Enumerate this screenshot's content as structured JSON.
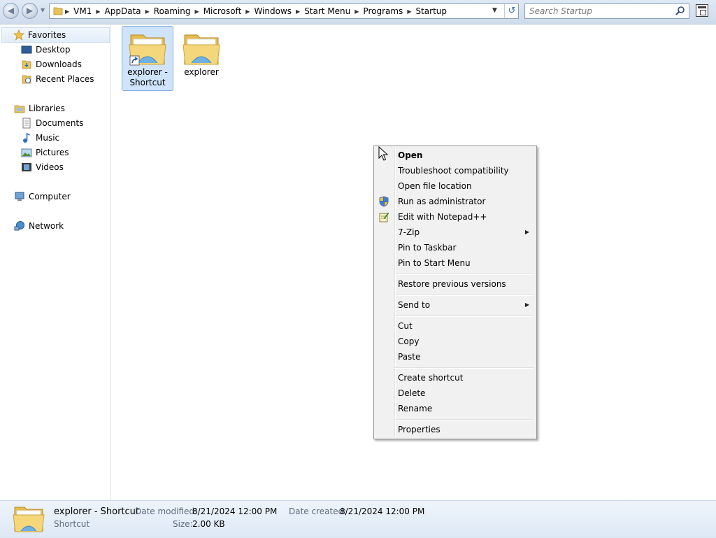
{
  "address_bar": {
    "crumbs": [
      "VM1",
      "AppData",
      "Roaming",
      "Microsoft",
      "Windows",
      "Start Menu",
      "Programs",
      "Startup"
    ]
  },
  "search": {
    "placeholder": "Search Startup"
  },
  "nav_pane": {
    "favorites": {
      "label": "Favorites",
      "items": [
        "Desktop",
        "Downloads",
        "Recent Places"
      ]
    },
    "libraries": {
      "label": "Libraries",
      "items": [
        "Documents",
        "Music",
        "Pictures",
        "Videos"
      ]
    },
    "computer": "Computer",
    "network": "Network"
  },
  "files": [
    {
      "name": "explorer - Shortcut",
      "line1": "explorer -",
      "line2": "Shortcut",
      "selected": true,
      "icon": "folder-shortcut-icon"
    },
    {
      "name": "explorer",
      "line1": "explorer",
      "line2": "",
      "selected": false,
      "icon": "folder-icon"
    }
  ],
  "context_menu": {
    "items": [
      {
        "label": "Open",
        "bold": true
      },
      {
        "label": "Troubleshoot compatibility"
      },
      {
        "label": "Open file location"
      },
      {
        "label": "Run as administrator",
        "icon": "uac-shield-icon"
      },
      {
        "label": "Edit with Notepad++",
        "icon": "notepadpp-icon"
      },
      {
        "label": "7-Zip",
        "submenu": true
      },
      {
        "label": "Pin to Taskbar"
      },
      {
        "label": "Pin to Start Menu"
      },
      {
        "label": "Restore previous versions"
      },
      {
        "label": "Send to",
        "submenu": true
      },
      {
        "label": "Cut"
      },
      {
        "label": "Copy"
      },
      {
        "label": "Paste"
      },
      {
        "label": "Create shortcut"
      },
      {
        "label": "Delete"
      },
      {
        "label": "Rename"
      },
      {
        "label": "Properties"
      }
    ]
  },
  "details": {
    "name": "explorer - Shortcut",
    "type": "Shortcut",
    "modified_label": "Date modified:",
    "modified_value": "8/21/2024 12:00 PM",
    "size_label": "Size:",
    "size_value": "2.00 KB",
    "created_label": "Date created:",
    "created_value": "8/21/2024 12:00 PM"
  },
  "colors": {
    "selection": "#cfe3fb",
    "selection_border": "#84acdd",
    "menu_bg": "#f1f1f1",
    "folder_yellow": "#f5d77b"
  }
}
